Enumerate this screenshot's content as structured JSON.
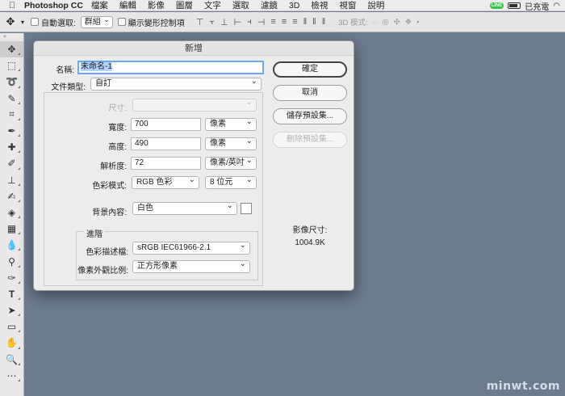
{
  "menubar": {
    "apple": "",
    "app": "Photoshop CC",
    "items": [
      "檔案",
      "編輯",
      "影像",
      "圖層",
      "文字",
      "選取",
      "濾鏡",
      "3D",
      "檢視",
      "視窗",
      "說明"
    ],
    "status": {
      "line_badge": "LINE",
      "charge": "已充電"
    }
  },
  "options": {
    "auto_select_label": "自動選取:",
    "auto_select_value": "群組",
    "show_transform_label": "顯示變形控制項",
    "mode_3d_label": "3D 模式:"
  },
  "dialog": {
    "title": "新增",
    "name_label": "名稱:",
    "name_value": "未命名-1",
    "preset_label": "文件類型:",
    "preset_value": "自訂",
    "size_label": "尺寸:",
    "size_value": "",
    "width_label": "寬度:",
    "width_value": "700",
    "width_unit": "像素",
    "height_label": "高度:",
    "height_value": "490",
    "height_unit": "像素",
    "resolution_label": "解析度:",
    "resolution_value": "72",
    "resolution_unit": "像素/英吋",
    "color_mode_label": "色彩模式:",
    "color_mode_value": "RGB 色彩",
    "bit_depth_value": "8 位元",
    "background_label": "背景內容:",
    "background_value": "白色",
    "advanced_title": "進階",
    "profile_label": "色彩描述檔:",
    "profile_value": "sRGB IEC61966-2.1",
    "pixel_aspect_label": "像素外觀比例:",
    "pixel_aspect_value": "正方形像素",
    "buttons": {
      "ok": "確定",
      "cancel": "取消",
      "save_preset": "儲存預設集...",
      "delete_preset": "刪除預設集..."
    },
    "image_size_label": "影像尺寸:",
    "image_size_value": "1004.9K"
  },
  "watermark": "minwt.com"
}
